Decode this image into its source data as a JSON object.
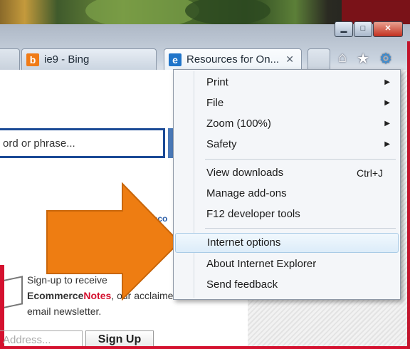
{
  "tabs": [
    {
      "label": "ie9 - Bing",
      "favicon": "bing-icon"
    },
    {
      "label": "Resources for On...",
      "favicon": "ie-icon",
      "close": "✕"
    }
  ],
  "window_controls": {
    "minimize": "▁",
    "maximize": "□",
    "close": "✕"
  },
  "toolbar_icons": [
    "home-icon",
    "favorites-star-icon",
    "tools-gear-icon"
  ],
  "page": {
    "search_placeholder": "ord or phrase...",
    "account_link": "Acco",
    "signup_line1": "Sign-up to receive",
    "signup_brand_a": "Ecommerce",
    "signup_brand_b": "Notes",
    "signup_line2_rest": ", our acclaimed",
    "signup_line3": "email newsletter.",
    "email_placeholder": "Address...",
    "signup_button": "Sign Up"
  },
  "tools_menu": {
    "items": [
      {
        "label": "Print",
        "submenu": true
      },
      {
        "label": "File",
        "submenu": true
      },
      {
        "label": "Zoom (100%)",
        "submenu": true
      },
      {
        "label": "Safety",
        "submenu": true
      },
      {
        "label": "View downloads",
        "shortcut": "Ctrl+J"
      },
      {
        "label": "Manage add-ons"
      },
      {
        "label": "F12 developer tools"
      },
      {
        "label": "Internet options",
        "highlighted": true
      },
      {
        "label": "About Internet Explorer"
      },
      {
        "label": "Send feedback"
      }
    ]
  },
  "colors": {
    "arrow": "#ee7d12",
    "accent_red": "#d4112f",
    "search_border": "#1b4a96"
  }
}
